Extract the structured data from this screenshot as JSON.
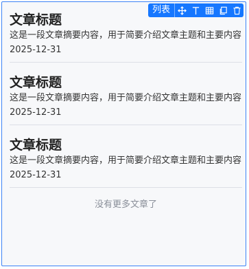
{
  "toolbar": {
    "label": "列表",
    "icons": [
      "move-icon",
      "align-top-icon",
      "table-icon",
      "copy-icon",
      "delete-icon"
    ]
  },
  "articles": [
    {
      "title": "文章标题",
      "summary": "这是一段文章摘要内容，用于简要介绍文章主题和主要内容",
      "date": "2025-12-31"
    },
    {
      "title": "文章标题",
      "summary": "这是一段文章摘要内容，用于简要介绍文章主题和主要内容",
      "date": "2025-12-31"
    },
    {
      "title": "文章标题",
      "summary": "这是一段文章摘要内容，用于简要介绍文章主题和主要内容",
      "date": "2025-12-31"
    }
  ],
  "footer": {
    "no_more_text": "没有更多文章了"
  },
  "colors": {
    "accent": "#1677ff",
    "selection_border": "#3b82f6",
    "background": "#f7f8fa",
    "divider": "#dcdfe6",
    "muted_text": "#8a8f99"
  }
}
